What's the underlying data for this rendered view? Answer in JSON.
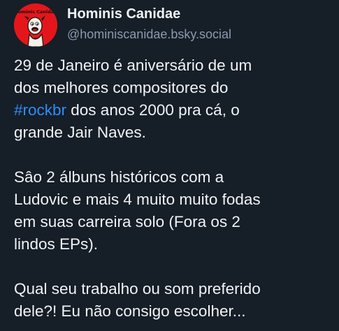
{
  "author": {
    "display_name": "Hominis Canidae",
    "handle": "@hominiscanidae.bsky.social",
    "avatar_icon": "dog-cartoon-avatar",
    "avatar_text": "Hominis Canidae"
  },
  "post": {
    "paragraph1": {
      "line1": "29 de Janeiro é aniversário de um",
      "line2": "dos melhores compositores do",
      "hashtag": "#rockbr",
      "line3_rest": " dos anos 2000 pra cá, o",
      "line4": "grande Jair Naves."
    },
    "paragraph2": {
      "line1": "Sâo 2 álbuns históricos com a",
      "line2": "Ludovic e mais 4 muito muito fodas",
      "line3": "em suas carreira solo (Fora os 2",
      "line4": "lindos EPs)."
    },
    "paragraph3": {
      "line1": "Qual seu trabalho ou som preferido",
      "line2": "dele?! Eu não consigo escolher..."
    }
  },
  "colors": {
    "background": "#161e27",
    "text": "#f1f3f5",
    "handle": "#8a9bb0",
    "hashtag": "#2f8dfa",
    "avatar_bg": "#e5161b"
  }
}
